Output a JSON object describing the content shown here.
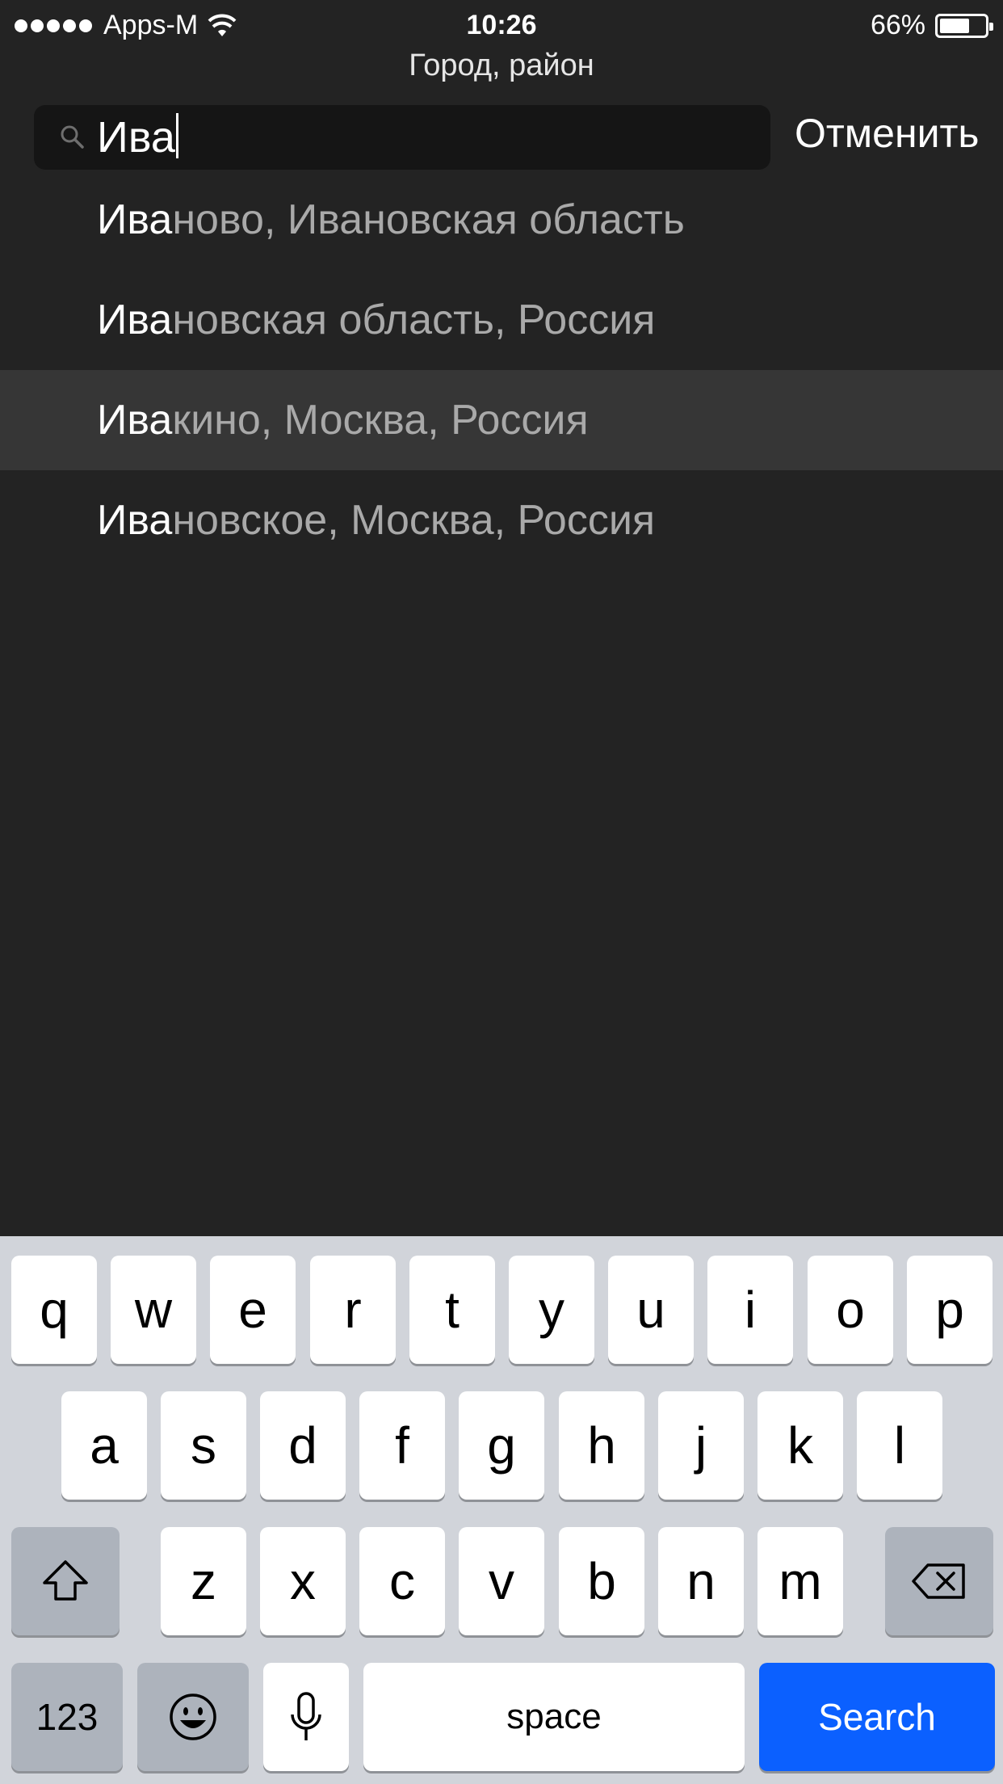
{
  "status_bar": {
    "carrier": "Apps-M",
    "time": "10:26",
    "battery_percent": "66%",
    "battery_level": 0.66,
    "signal_dots": 5
  },
  "header": {
    "title": "Город, район"
  },
  "search": {
    "value": "Ива",
    "cancel_label": "Отменить"
  },
  "suggestions": [
    {
      "match": "Ива",
      "rest": "ново, Ивановская область",
      "highlighted": false
    },
    {
      "match": "Ива",
      "rest": "новская область, Россия",
      "highlighted": false
    },
    {
      "match": "Ива",
      "rest": "кино, Москва, Россия",
      "highlighted": true
    },
    {
      "match": "Ива",
      "rest": "новское, Москва, Россия",
      "highlighted": false
    }
  ],
  "keyboard": {
    "row1": [
      "q",
      "w",
      "e",
      "r",
      "t",
      "y",
      "u",
      "i",
      "o",
      "p"
    ],
    "row2": [
      "a",
      "s",
      "d",
      "f",
      "g",
      "h",
      "j",
      "k",
      "l"
    ],
    "row3": [
      "z",
      "x",
      "c",
      "v",
      "b",
      "n",
      "m"
    ],
    "shift_icon": "shift-icon",
    "delete_icon": "delete-icon",
    "numbers_label": "123",
    "emoji_icon": "emoji-icon",
    "mic_icon": "microphone-icon",
    "space_label": "space",
    "search_label": "Search"
  },
  "colors": {
    "background": "#232323",
    "highlight_row": "#363636",
    "search_key": "#0b60ff",
    "keyboard_bg": "#d1d4da"
  }
}
